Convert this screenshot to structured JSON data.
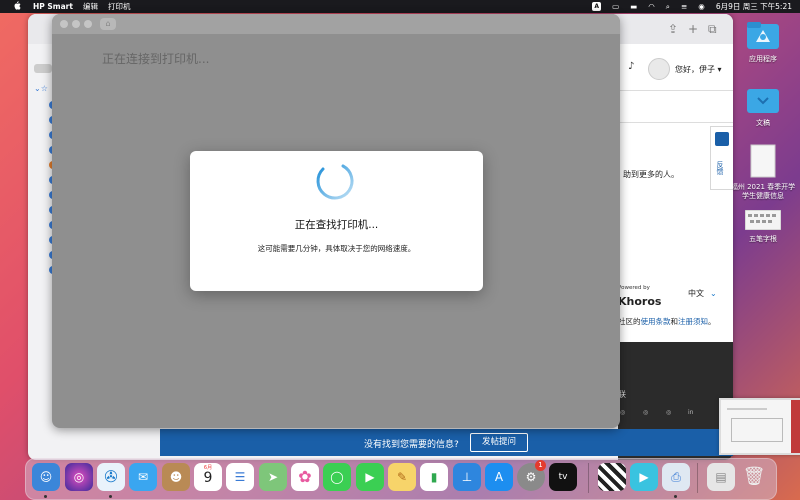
{
  "menubar": {
    "app_name": "HP Smart",
    "menus": [
      "编辑",
      "打印机"
    ],
    "ime": "A",
    "datetime": "6月9日 周三 下午5:21"
  },
  "hp_window": {
    "status_text": "正在连接到打印机..."
  },
  "modal": {
    "title": "正在查找打印机...",
    "subtitle": "这可能需要几分钟，具体取决于您的网络速度。"
  },
  "browser_page": {
    "greeting": "您好，伊子",
    "sentence_fragment": "助到更多的人。",
    "side_tab": "反馈",
    "powered_by": "Powered by",
    "khoros": "Khoros",
    "language": "中文",
    "terms_prefix": "社区的",
    "terms_link1": "使用条款",
    "terms_and": "和",
    "terms_link2": "注册须知",
    "terms_suffix": "。",
    "dark_label": "联",
    "bottom_question": "没有找到您需要的信息?",
    "bottom_button": "发帖提问"
  },
  "desktop_icons": [
    {
      "label": "应用程序",
      "icon": "app-store-folder-icon"
    },
    {
      "label": "文稿",
      "icon": "documents-folder-icon"
    },
    {
      "label": "福州 2021 春季开学学生健康信息",
      "icon": "document-file-icon"
    },
    {
      "label": "五笔字根",
      "icon": "keyboard-image-icon"
    }
  ],
  "dock": {
    "calendar_month": "6月",
    "calendar_day": "9",
    "appstore_badge": "1",
    "tv_label": "tv"
  }
}
